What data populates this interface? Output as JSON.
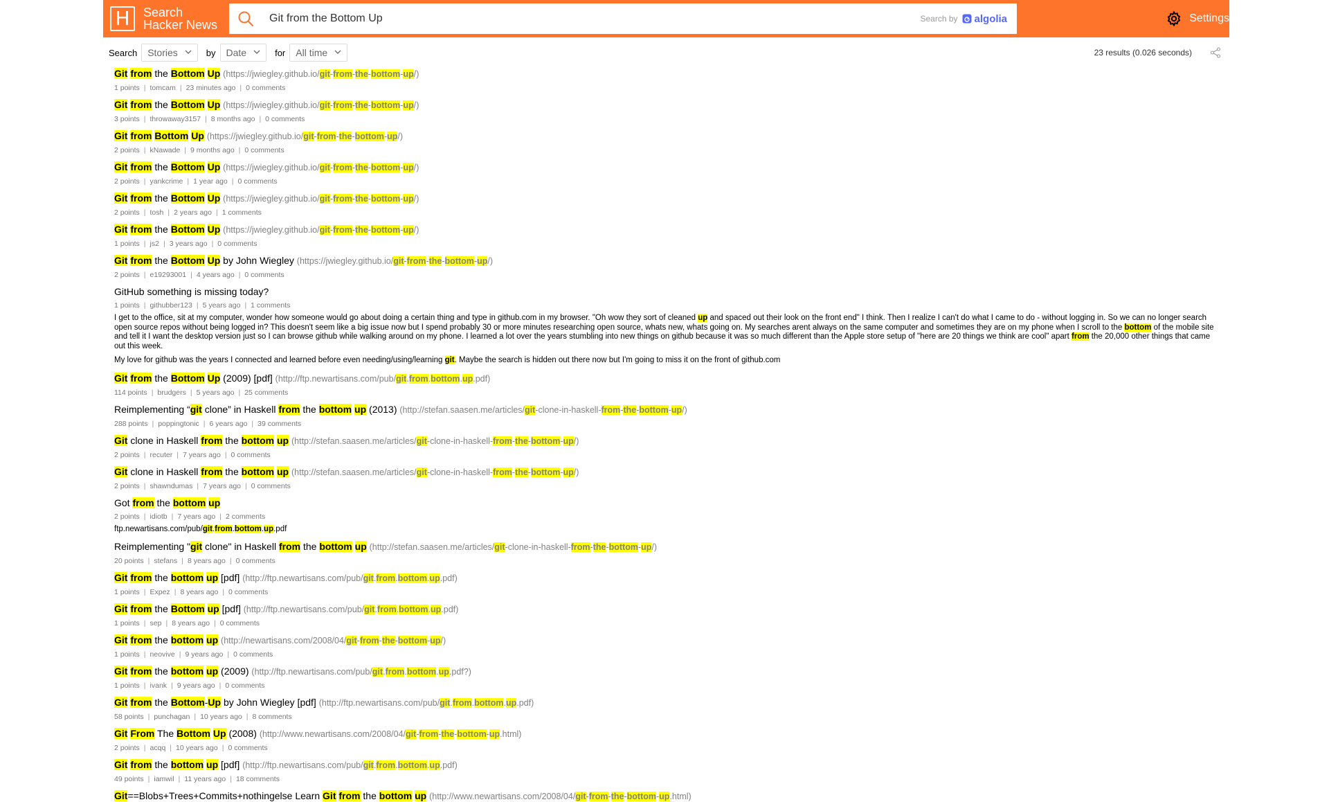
{
  "header": {
    "logo_letter": "H",
    "logo_line1": "Search",
    "logo_line2": "Hacker News",
    "search_value": "Git from the Bottom Up",
    "search_by": "Search by",
    "algolia": "algolia",
    "settings": "Settings",
    "accent_color": "#ff742b"
  },
  "filters": {
    "search_label": "Search",
    "type": "Stories",
    "by_label": "by",
    "sort": "Date",
    "for_label": "for",
    "range": "All time",
    "stats": "23 results (0.026 seconds)"
  },
  "results": [
    {
      "title": "[[Git]] [[from]] the [[Bottom]] [[Up]]",
      "url": "(https://jwiegley.github.io/[[git]]-[[from]]-[[the]]-[[bottom]]-[[up]]/)",
      "points": "1 points",
      "author": "tomcam",
      "time": "23 minutes ago",
      "comments": "0 comments"
    },
    {
      "title": "[[Git]] [[from]] the [[Bottom]] [[Up]]",
      "url": "(https://jwiegley.github.io/[[git]]-[[from]]-[[the]]-[[bottom]]-[[up]]/)",
      "points": "3 points",
      "author": "throwaway3157",
      "time": "8 months ago",
      "comments": "0 comments"
    },
    {
      "title": "[[Git]] [[from]] [[Bottom]] [[Up]]",
      "url": "(https://jwiegley.github.io/[[git]]-[[from]]-[[the]]-[[bottom]]-[[up]]/)",
      "points": "2 points",
      "author": "kNawade",
      "time": "9 months ago",
      "comments": "0 comments"
    },
    {
      "title": "[[Git]] [[from]] the [[Bottom]] [[Up]]",
      "url": "(https://jwiegley.github.io/[[git]]-[[from]]-[[the]]-[[bottom]]-[[up]]/)",
      "points": "2 points",
      "author": "yankcrime",
      "time": "1 year ago",
      "comments": "0 comments"
    },
    {
      "title": "[[Git]] [[from]] the [[Bottom]] [[Up]]",
      "url": "(https://jwiegley.github.io/[[git]]-[[from]]-[[the]]-[[bottom]]-[[up]]/)",
      "points": "2 points",
      "author": "tosh",
      "time": "2 years ago",
      "comments": "1 comments"
    },
    {
      "title": "[[Git]] [[from]] the [[Bottom]] [[Up]]",
      "url": "(https://jwiegley.github.io/[[git]]-[[from]]-[[the]]-[[bottom]]-[[up]]/)",
      "points": "1 points",
      "author": "js2",
      "time": "3 years ago",
      "comments": "0 comments"
    },
    {
      "title": "[[Git]] [[from]] the [[Bottom]] [[Up]] by John Wiegley",
      "url": "(https://jwiegley.github.io/[[git]]-[[from]]-[[the]]-[[bottom]]-[[up]]/)",
      "points": "2 points",
      "author": "e19293001",
      "time": "4 years ago",
      "comments": "0 comments"
    },
    {
      "title": "GitHub something is missing today?",
      "url": "",
      "points": "1 points",
      "author": "githubber123",
      "time": "5 years ago",
      "comments": "1 comments",
      "text": [
        "I get to the office, sit at my computer, wonder how someone would go about doing a certain thing and type in github.com in my browser. \"Oh wow they sort of cleaned [[up]] and spaced out their look on the front end\" I think. Then I realize I can't do what I came to do - without logging in. So we can no longer search open source repos without being logged in? This doesn't seem like a big issue now but I spend probably 30 or more minutes researching open source, whats new, whats going on. My searches arent always on the same computer and sometimes they are on my phone when I scroll to the [[bottom]] of the mobile site and tell it I want the desktop version just so I can browse github while walking around on my phone. I learned a lot over the years stumbling into new things on github because it was so much different than the Apple store setup of \"here are 20 things we think are cool\" apart [[from]] the 20,000 other things that came out this week.",
        "My love for github was the years I connected and learned before even needing/using/learning [[git]]. Maybe the search is hidden out there now but I'm going to miss it on the front of github.com"
      ]
    },
    {
      "title": "[[Git]] [[from]] the [[Bottom]] [[Up]] (2009) [pdf]",
      "url": "(http://ftp.newartisans.com/pub/[[git]].[[from]].[[bottom]].[[up]].pdf)",
      "points": "114 points",
      "author": "brudgers",
      "time": "5 years ago",
      "comments": "25 comments"
    },
    {
      "title": "Reimplementing “[[git]] clone” in Haskell [[from]] the [[bottom]] [[up]] (2013)",
      "url": "(http://stefan.saasen.me/articles/[[git]]-clone-in-haskell-[[from]]-[[the]]-[[bottom]]-[[up]]/)",
      "points": "288 points",
      "author": "poppingtonic",
      "time": "6 years ago",
      "comments": "39 comments"
    },
    {
      "title": "[[Git]] clone in Haskell [[from]] the [[bottom]] [[up]]",
      "url": "(http://stefan.saasen.me/articles/[[git]]-clone-in-haskell-[[from]]-[[the]]-[[bottom]]-[[up]]/)",
      "points": "2 points",
      "author": "recuter",
      "time": "7 years ago",
      "comments": "0 comments"
    },
    {
      "title": "[[Git]] clone in Haskell [[from]] the [[bottom]] [[up]]",
      "url": "(http://stefan.saasen.me/articles/[[git]]-clone-in-haskell-[[from]]-[[the]]-[[bottom]]-[[up]]/)",
      "points": "2 points",
      "author": "shawndumas",
      "time": "7 years ago",
      "comments": "0 comments"
    },
    {
      "title": "Got [[from]] the [[bottom]] [[up]]",
      "url": "",
      "points": "2 points",
      "author": "idiotb",
      "time": "7 years ago",
      "comments": "2 comments",
      "text": [
        "ftp.newartisans.com/pub/[[git]].[[from]].[[bottom]].[[up]].pdf"
      ]
    },
    {
      "title": "Reimplementing \"[[git]] clone\" in Haskell [[from]] the [[bottom]] [[up]]",
      "url": "(http://stefan.saasen.me/articles/[[git]]-clone-in-haskell-[[from]]-[[the]]-[[bottom]]-[[up]]/)",
      "points": "20 points",
      "author": "stefans",
      "time": "8 years ago",
      "comments": "0 comments"
    },
    {
      "title": "[[Git]] [[from]] the [[bottom]] [[up]] [pdf]",
      "url": "(http://ftp.newartisans.com/pub/[[git]].[[from]].[[bottom]].[[up]].pdf)",
      "points": "1 points",
      "author": "Expez",
      "time": "8 years ago",
      "comments": "0 comments"
    },
    {
      "title": "[[Git]] [[from]] the [[Bottom]] [[up]] [pdf]",
      "url": "(http://ftp.newartisans.com/pub/[[git]].[[from]].[[bottom]].[[up]].pdf)",
      "points": "1 points",
      "author": "sep",
      "time": "8 years ago",
      "comments": "0 comments"
    },
    {
      "title": "[[Git]] [[from]] the [[bottom]] [[up]]",
      "url": "(http://newartisans.com/2008/04/[[git]]-[[from]]-[[the]]-[[bottom]]-[[up]]/)",
      "points": "1 points",
      "author": "neovive",
      "time": "9 years ago",
      "comments": "0 comments"
    },
    {
      "title": "[[Git]] [[from]] the [[bottom]] [[up]] (2009)",
      "url": "(http://ftp.newartisans.com/pub/[[git]].[[from]].[[bottom]].[[up]].pdf?)",
      "points": "1 points",
      "author": "ivank",
      "time": "9 years ago",
      "comments": "0 comments"
    },
    {
      "title": "[[Git]] [[from]] the [[Bottom]]-[[Up]] by John Wiegley [pdf]",
      "url": "(http://ftp.newartisans.com/pub/[[git]].[[from]].[[bottom]].[[up]].pdf)",
      "points": "58 points",
      "author": "punchagan",
      "time": "10 years ago",
      "comments": "8 comments"
    },
    {
      "title": "[[Git]] [[From]] The [[Bottom]] [[Up]] (2008)",
      "url": "(http://www.newartisans.com/2008/04/[[git]]-[[from]]-[[the]]-[[bottom]]-[[up]].html)",
      "points": "2 points",
      "author": "acqq",
      "time": "10 years ago",
      "comments": "0 comments"
    },
    {
      "title": "[[Git]] [[from]] the [[bottom]] [[up]] [pdf]",
      "url": "(http://ftp.newartisans.com/pub/[[git]].[[from]].[[bottom]].[[up]].pdf)",
      "points": "49 points",
      "author": "iamwil",
      "time": "11 years ago",
      "comments": "18 comments"
    },
    {
      "title": "[[Git]]==Blobs+Trees+Commits+nothingelse Learn [[Git]] [[from]] the [[bottom]] [[up]]",
      "url": "(http://www.newartisans.com/2008/04/[[git]]-[[from]]-[[the]]-[[bottom]]-[[up]].html)",
      "points": "",
      "author": "",
      "time": "",
      "comments": ""
    }
  ]
}
